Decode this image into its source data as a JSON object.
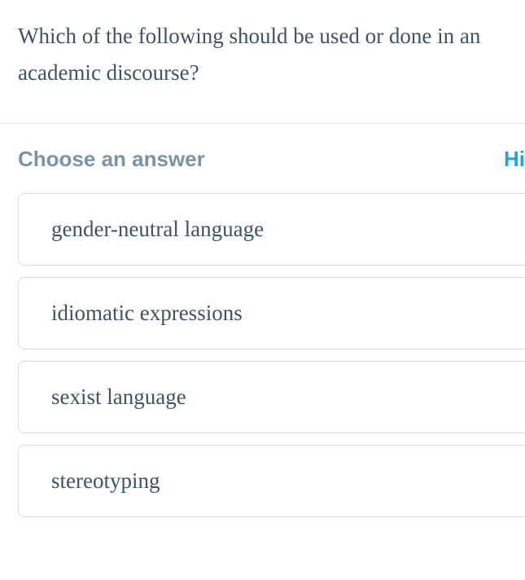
{
  "question": {
    "text": "Which of the following should be used or done in an academic discourse?"
  },
  "answer_section": {
    "choose_label": "Choose an answer",
    "hint_label": "Hi",
    "options": [
      {
        "text": "gender-neutral language"
      },
      {
        "text": "idiomatic expressions"
      },
      {
        "text": "sexist language"
      },
      {
        "text": "stereotyping"
      }
    ]
  }
}
